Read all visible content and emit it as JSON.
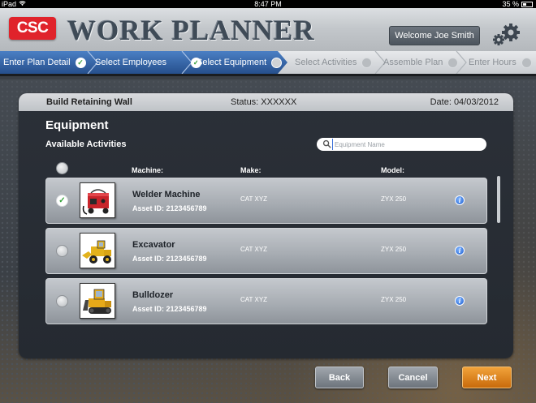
{
  "status_bar": {
    "device": "iPad",
    "time": "8:47 PM",
    "battery": "35 %"
  },
  "header": {
    "logo": "CSC",
    "title": "WORK PLANNER",
    "welcome": "Welcome Joe Smith"
  },
  "steps": [
    {
      "label": "Enter Plan Detail",
      "state": "done"
    },
    {
      "label": "Select Employees",
      "state": "done"
    },
    {
      "label": "Select Equipment",
      "state": "active"
    },
    {
      "label": "Select Activities",
      "state": "todo"
    },
    {
      "label": "Assemble Plan",
      "state": "todo"
    },
    {
      "label": "Enter Hours",
      "state": "todo"
    }
  ],
  "plan": {
    "name": "Build Retaining Wall",
    "status": "Status: XXXXXX",
    "date": "Date: 04/03/2012"
  },
  "section": {
    "title": "Equipment",
    "subtitle": "Available Activities"
  },
  "search": {
    "placeholder": "Equipment Name",
    "value": ""
  },
  "columns": {
    "machine": "Machine:",
    "make": "Make:",
    "model": "Model:"
  },
  "rows": [
    {
      "name": "Welder Machine",
      "asset": "Asset ID: 2123456789",
      "make": "CAT XYZ",
      "model": "ZYX 250",
      "selected": true,
      "image": "welder-machine"
    },
    {
      "name": "Excavator",
      "asset": "Asset ID: 2123456789",
      "make": "CAT XYZ",
      "model": "ZYX 250",
      "selected": false,
      "image": "excavator"
    },
    {
      "name": "Bulldozer",
      "asset": "Asset ID: 2123456789",
      "make": "CAT XYZ",
      "model": "ZYX 250",
      "selected": false,
      "image": "bulldozer"
    }
  ],
  "buttons": {
    "back": "Back",
    "cancel": "Cancel",
    "next": "Next"
  },
  "colors": {
    "brand_red": "#e0232b",
    "step_blue": "#2f5fa0",
    "check_green": "#34a33a",
    "next_orange": "#e58a1f"
  }
}
